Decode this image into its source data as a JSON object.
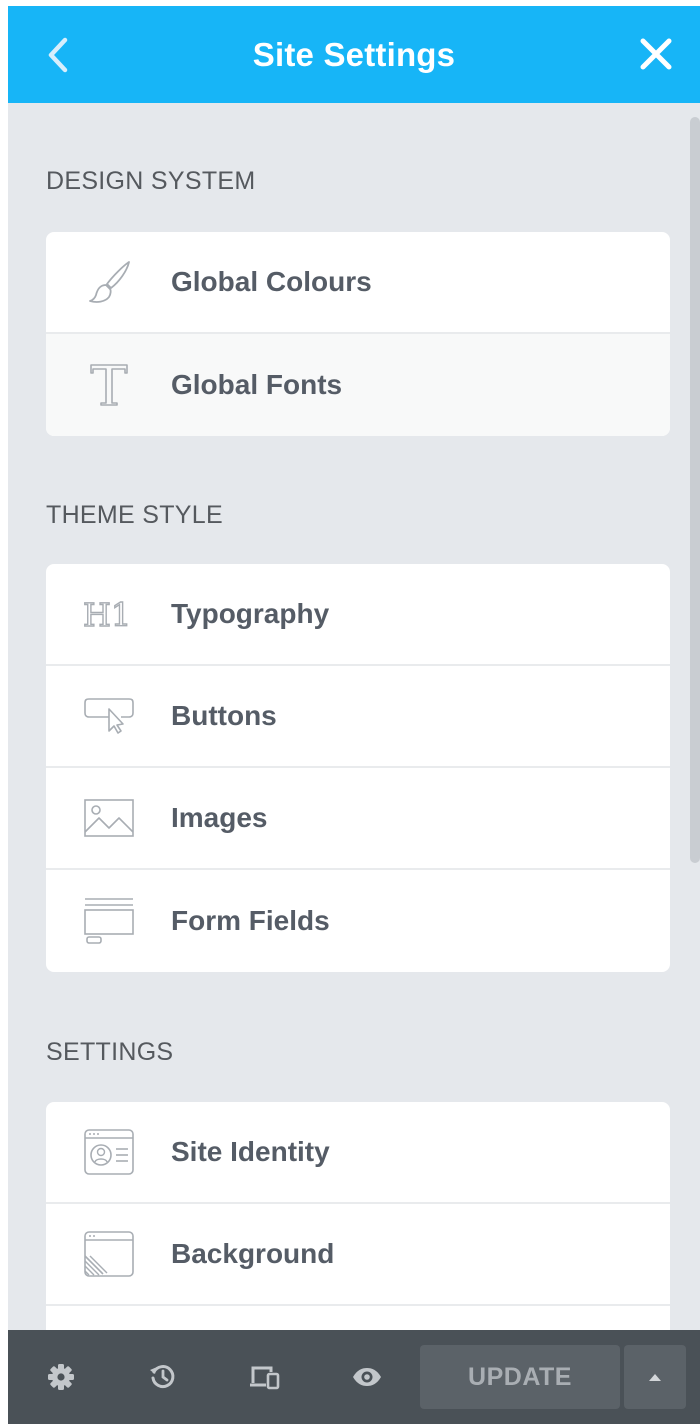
{
  "header": {
    "title": "Site Settings",
    "back_icon": "chevron-left-icon",
    "close_icon": "close-icon"
  },
  "sections": [
    {
      "title": "DESIGN SYSTEM",
      "items": [
        {
          "label": "Global Colours",
          "icon": "paintbrush-icon"
        },
        {
          "label": "Global Fonts",
          "icon": "typeface-icon"
        }
      ]
    },
    {
      "title": "THEME STYLE",
      "items": [
        {
          "label": "Typography",
          "icon": "heading-icon"
        },
        {
          "label": "Buttons",
          "icon": "button-cursor-icon"
        },
        {
          "label": "Images",
          "icon": "image-icon"
        },
        {
          "label": "Form Fields",
          "icon": "form-field-icon"
        }
      ]
    },
    {
      "title": "SETTINGS",
      "items": [
        {
          "label": "Site Identity",
          "icon": "site-identity-icon"
        },
        {
          "label": "Background",
          "icon": "background-icon"
        }
      ]
    }
  ],
  "footer": {
    "update_label": "UPDATE",
    "icons": [
      "gear-icon",
      "history-icon",
      "responsive-icon",
      "eye-icon",
      "caret-up-icon"
    ]
  },
  "colors": {
    "header": "#17b5f7",
    "panel_bg": "#e5e8ec",
    "footer": "#4a5157",
    "label": "#555c66"
  }
}
